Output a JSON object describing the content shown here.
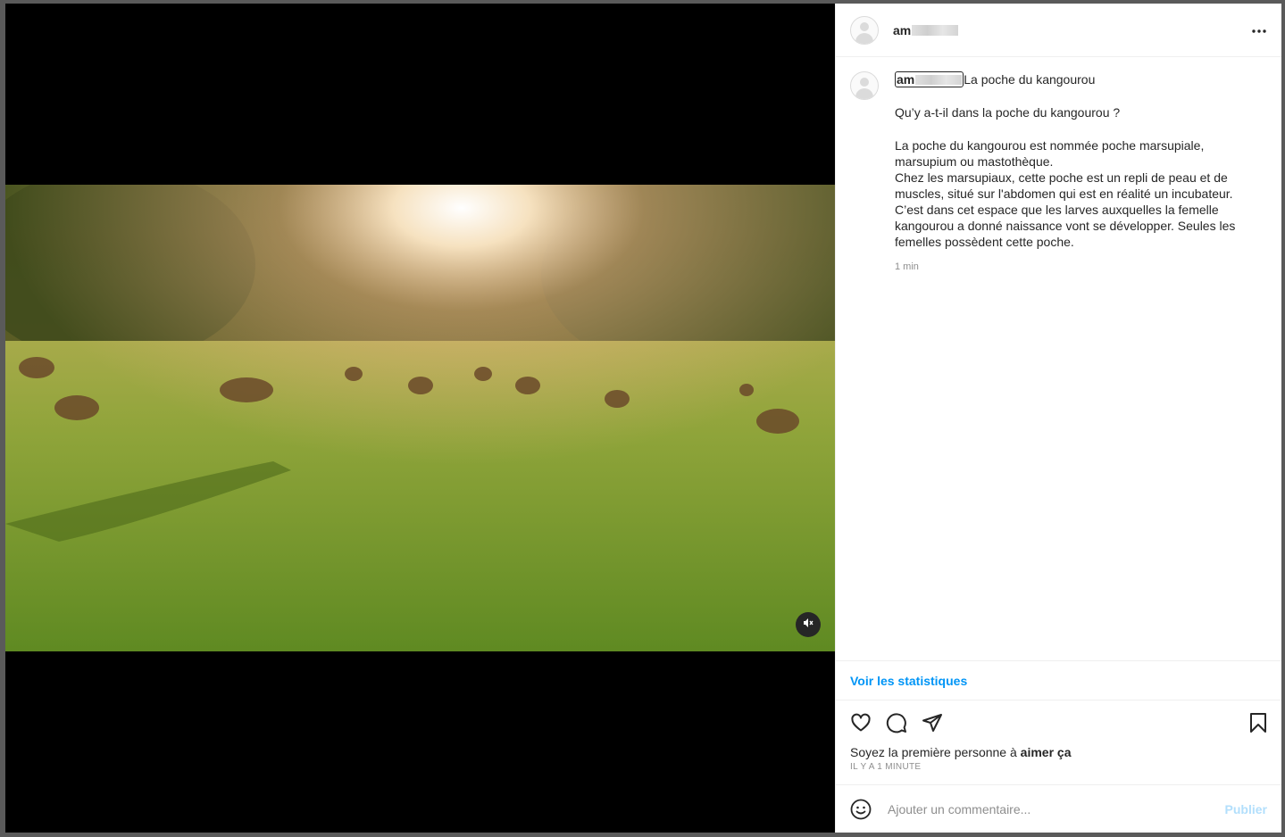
{
  "post": {
    "username_visible": "am",
    "caption_title": "La poche du kangourou",
    "caption_question": "Qu’y a-t-il dans la poche du kangourou ?",
    "caption_body": "La poche du kangourou est nommée poche marsupiale, marsupium ou mastothèque.\nChez les marsupiaux, cette poche est un repli de peau et de muscles, situé sur l'abdomen qui est en réalité un incubateur. C’est dans cet espace que les larves auxquelles la femelle kangourou a donné naissance vont se développer. Seules les femelles possèdent cette poche.",
    "caption_time": "1 min"
  },
  "stats_link": "Voir les statistiques",
  "likes": {
    "prefix": "Soyez la première personne à ",
    "bold": "aimer ça"
  },
  "timestamp": "IL Y A 1 MINUTE",
  "comment": {
    "placeholder": "Ajouter un commentaire...",
    "publish_label": "Publier"
  },
  "icons": {
    "more": "more-options-icon",
    "mute": "muted-speaker-icon",
    "like": "heart-icon",
    "comment": "comment-bubble-icon",
    "share": "paper-plane-icon",
    "save": "bookmark-icon",
    "emoji": "smiley-icon"
  },
  "colors": {
    "link": "#0095f6",
    "publish_disabled": "#b2dffc",
    "secondary_text": "#8e8e8e"
  }
}
